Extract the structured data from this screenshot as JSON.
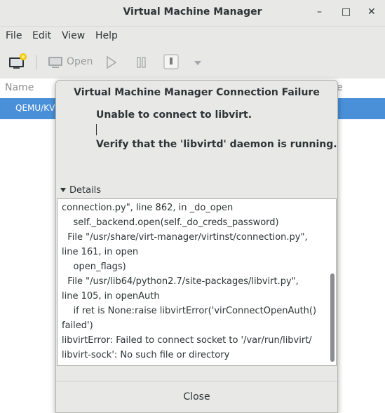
{
  "window": {
    "title": "Virtual Machine Manager",
    "controls": {
      "minimize": "–",
      "maximize": "□",
      "close": "✕"
    }
  },
  "menubar": {
    "items": [
      "File",
      "Edit",
      "View",
      "Help"
    ]
  },
  "toolbar": {
    "open_label": "Open"
  },
  "list": {
    "columns": [
      "Name",
      "e"
    ],
    "rows": [
      {
        "label": "QEMU/KVN"
      }
    ]
  },
  "dialog": {
    "title": "Virtual Machine Manager Connection Failure",
    "primary_message": "Unable to connect to libvirt.",
    "secondary_message": "Verify that the 'libvirtd' daemon is running.",
    "details_label": "Details",
    "details_text": "connection.py\", line 862, in _do_open\n    self._backend.open(self._do_creds_password)\n  File \"/usr/share/virt-manager/virtinst/connection.py\",\nline 161, in open\n    open_flags)\n  File \"/usr/lib64/python2.7/site-packages/libvirt.py\",\nline 105, in openAuth\n    if ret is None:raise libvirtError('virConnectOpenAuth()\nfailed')\nlibvirtError: Failed to connect socket to '/var/run/libvirt/\nlibvirt-sock': No such file or directory",
    "close_label": "Close"
  },
  "colors": {
    "selection": "#4a90d9",
    "chrome": "#e8e8e7"
  }
}
